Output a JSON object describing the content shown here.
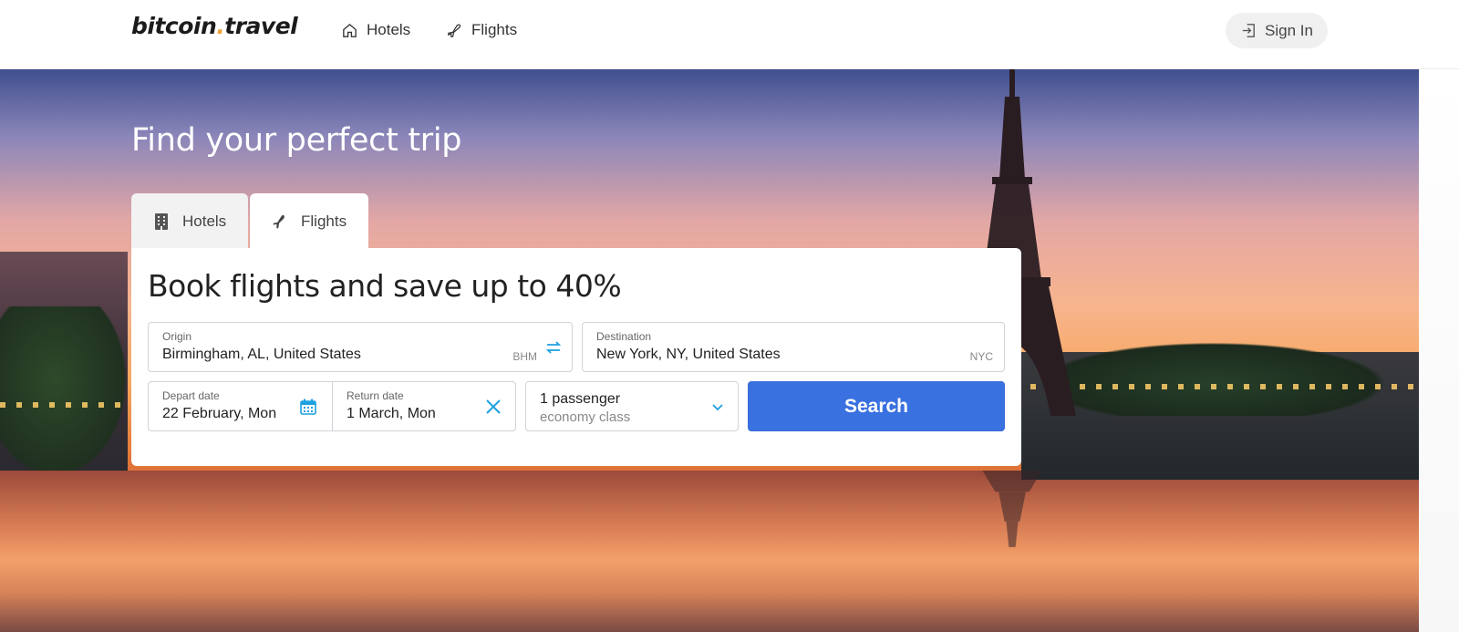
{
  "header": {
    "logo_main": "bitcoin",
    "logo_dot": ".",
    "logo_tail": "travel",
    "nav": [
      {
        "label": "Hotels",
        "icon": "home-icon"
      },
      {
        "label": "Flights",
        "icon": "plane-icon"
      }
    ],
    "signin_label": "Sign In"
  },
  "hero": {
    "headline": "Find your perfect trip",
    "tabs": [
      {
        "label": "Hotels",
        "icon": "building-icon",
        "active": false
      },
      {
        "label": "Flights",
        "icon": "plane-icon",
        "active": true
      }
    ]
  },
  "search": {
    "title": "Book flights and save up to 40%",
    "origin": {
      "label": "Origin",
      "value": "Birmingham, AL, United States",
      "code": "BHM"
    },
    "destination": {
      "label": "Destination",
      "value": "New York, NY, United States",
      "code": "NYC"
    },
    "depart": {
      "label": "Depart date",
      "value": "22 February, Mon"
    },
    "return": {
      "label": "Return date",
      "value": "1 March, Mon"
    },
    "passengers": {
      "value": "1 passenger",
      "class": "economy class"
    },
    "search_label": "Search"
  },
  "colors": {
    "accent": "#3a71e0",
    "icon_blue": "#1ea0e0",
    "logo_dot": "#f2a33a"
  }
}
